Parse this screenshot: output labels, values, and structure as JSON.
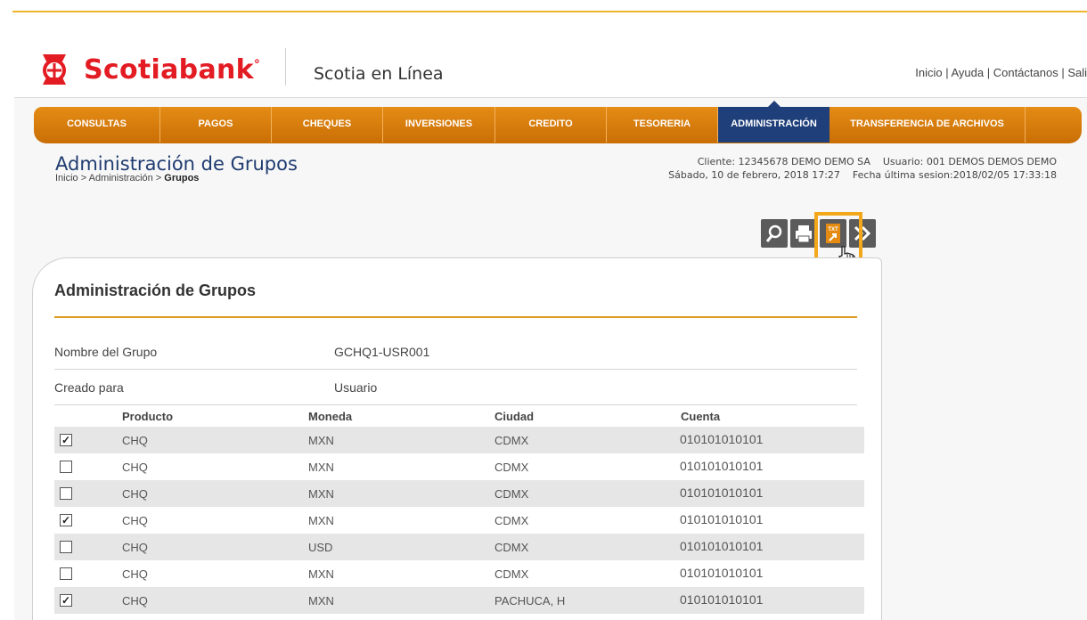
{
  "brand": {
    "name": "Scotiabank",
    "registered": "°",
    "product": "Scotia en Línea",
    "accent": "#e31b23",
    "nav_color": "#e48c15",
    "nav_active_color": "#1f3f7a"
  },
  "top_links": "Inicio | Ayuda | Contáctanos | Sali",
  "nav": [
    {
      "label": "CONSULTAS",
      "active": false
    },
    {
      "label": "PAGOS",
      "active": false
    },
    {
      "label": "CHEQUES",
      "active": false
    },
    {
      "label": "INVERSIONES",
      "active": false
    },
    {
      "label": "CREDITO",
      "active": false
    },
    {
      "label": "TESORERIA",
      "active": false
    },
    {
      "label": "ADMINISTRACIÓN",
      "active": true
    },
    {
      "label": "TRANSFERENCIA DE ARCHIVOS",
      "active": false
    }
  ],
  "page": {
    "title": "Administración de Grupos",
    "breadcrumb_prefix": "Inicio > Administración > ",
    "breadcrumb_current": "Grupos"
  },
  "session": {
    "line1": "Cliente: 12345678 DEMO DEMO SA    Usuario: 001 DEMOS DEMOS DEMO",
    "line2": "Sábado, 10 de febrero, 2018 17:27    Fecha última sesion:2018/02/05 17:33:18"
  },
  "toolbar": [
    {
      "icon": "search-icon"
    },
    {
      "icon": "print-icon"
    },
    {
      "icon": "txt-export-icon",
      "label": "TXT",
      "highlighted": true
    },
    {
      "icon": "double-chevron-right-icon"
    }
  ],
  "card": {
    "title": "Administración de Grupos",
    "fields": [
      {
        "label": "Nombre del Grupo",
        "value": "GCHQ1-USR001"
      },
      {
        "label": "Creado para",
        "value": "Usuario"
      }
    ],
    "columns": [
      "Producto",
      "Moneda",
      "Ciudad",
      "Cuenta"
    ],
    "rows": [
      {
        "checked": true,
        "producto": "CHQ",
        "moneda": "MXN",
        "ciudad": "CDMX",
        "cuenta": "010101010101"
      },
      {
        "checked": false,
        "producto": "CHQ",
        "moneda": "MXN",
        "ciudad": "CDMX",
        "cuenta": "010101010101"
      },
      {
        "checked": false,
        "producto": "CHQ",
        "moneda": "MXN",
        "ciudad": "CDMX",
        "cuenta": "010101010101"
      },
      {
        "checked": true,
        "producto": "CHQ",
        "moneda": "MXN",
        "ciudad": "CDMX",
        "cuenta": "010101010101"
      },
      {
        "checked": false,
        "producto": "CHQ",
        "moneda": "USD",
        "ciudad": "CDMX",
        "cuenta": "010101010101"
      },
      {
        "checked": false,
        "producto": "CHQ",
        "moneda": "MXN",
        "ciudad": "CDMX",
        "cuenta": "010101010101"
      },
      {
        "checked": true,
        "producto": "CHQ",
        "moneda": "MXN",
        "ciudad": "PACHUCA, H",
        "cuenta": "010101010101"
      }
    ]
  }
}
